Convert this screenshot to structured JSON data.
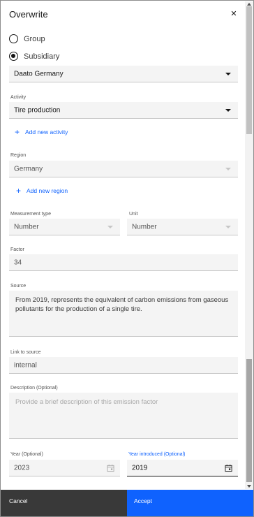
{
  "dialog": {
    "title": "Overwrite",
    "close_icon": "close-icon"
  },
  "scope": {
    "options": [
      {
        "label": "Group",
        "checked": false
      },
      {
        "label": "Subsidiary",
        "checked": true
      }
    ],
    "subsidiary_value": "Daato Germany"
  },
  "activity": {
    "label": "Activity",
    "value": "Tire production",
    "add_label": "Add new activity"
  },
  "region": {
    "label": "Region",
    "value": "Germany",
    "add_label": "Add new region"
  },
  "measurement": {
    "type_label": "Measurement type",
    "type_value": "Number",
    "unit_label": "Unit",
    "unit_value": "Number"
  },
  "factor": {
    "label": "Factor",
    "value": "34"
  },
  "source": {
    "label": "Source",
    "value": "From 2019, represents the equivalent of carbon emissions from gaseous pollutants for the production of a single tire."
  },
  "link": {
    "label": "Link to source",
    "value": "internal"
  },
  "description": {
    "label": "Description (Optional)",
    "placeholder": "Provide a brief description of this emission factor"
  },
  "year": {
    "label": "Year (Optional)",
    "value": "2023"
  },
  "year_introduced": {
    "label": "Year introduced (Optional)",
    "value": "2019"
  },
  "footer": {
    "cancel_label": "Cancel",
    "accept_label": "Accept"
  },
  "colors": {
    "primary": "#0f62fe",
    "secondary": "#393939",
    "field_bg": "#f4f4f4"
  }
}
